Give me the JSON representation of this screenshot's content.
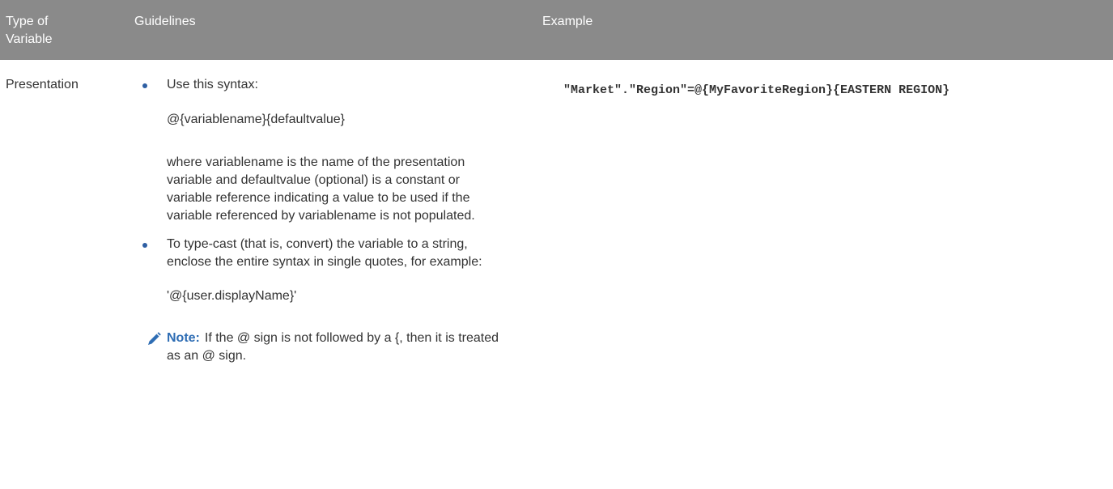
{
  "table": {
    "headers": {
      "type": "Type of\nVariable",
      "guidelines": "Guidelines",
      "example": "Example"
    },
    "rows": [
      {
        "type": "Presentation",
        "guidelines": {
          "bullet1": "Use this syntax:",
          "syntax": "@{variablename}{defaultvalue}",
          "explanation": "where variablename is the name of the presentation variable and defaultvalue (optional) is a constant or variable reference indicating a value to be used if the variable referenced by variablename is not populated.",
          "bullet2": "To type-cast (that is, convert) the variable to a string, enclose the entire syntax in single quotes, for example:",
          "cast_example": "'@{user.displayName}'",
          "note_label": "Note:",
          "note_text": "If the @ sign is not followed by a {, then it is treated as an @ sign."
        },
        "example": "\"Market\".\"Region\"=@{MyFavoriteRegion}{EASTERN REGION}"
      }
    ]
  },
  "colors": {
    "header_bg": "#8a8a8a",
    "accent": "#2e6db4",
    "bullet": "#2e5fa3"
  },
  "icons": {
    "note": "pencil-icon"
  }
}
